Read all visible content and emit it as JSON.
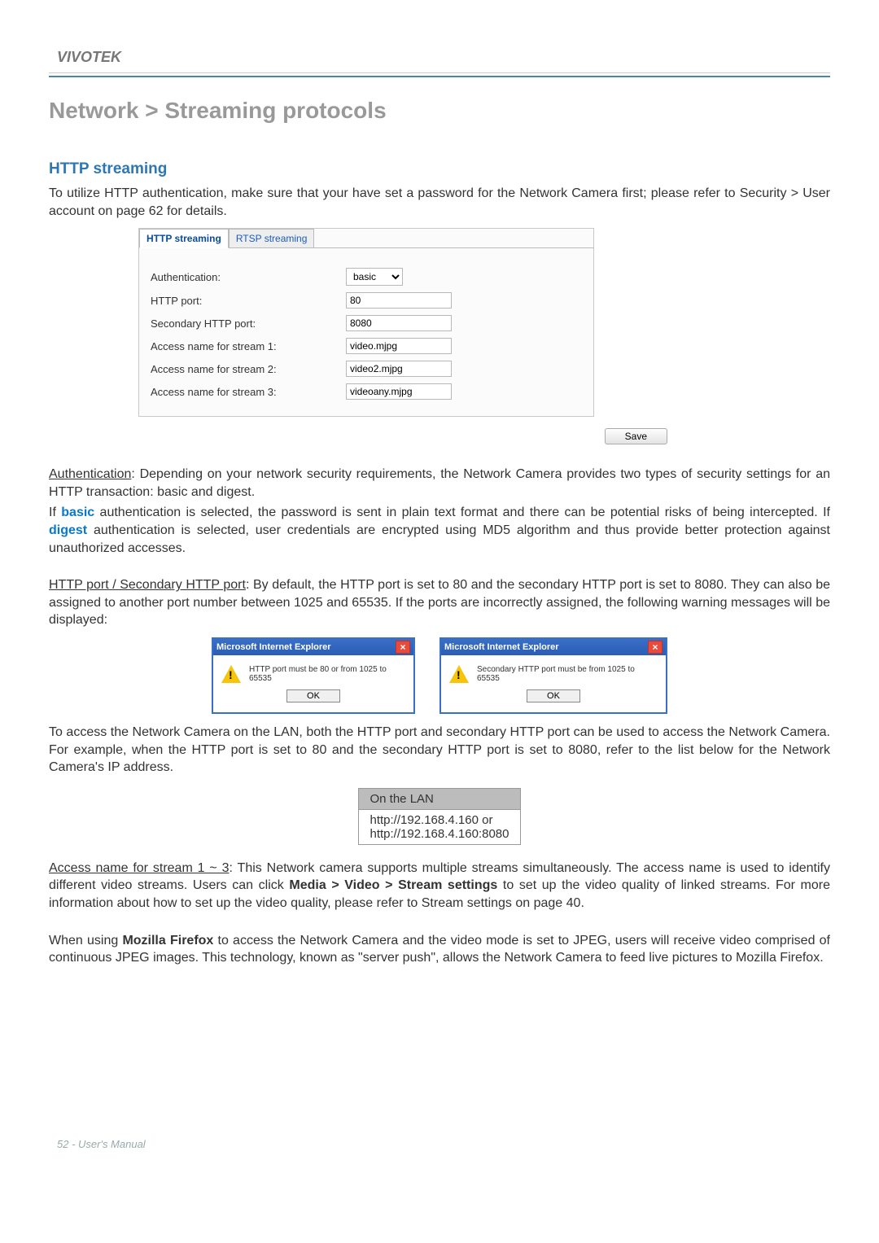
{
  "brand": "VIVOTEK",
  "title": "Network > Streaming protocols",
  "section": "HTTP streaming",
  "intro": "To utilize HTTP authentication, make sure that your have set a password for the Network Camera first; please refer to Security > User account on page 62 for details.",
  "tabs": {
    "http": "HTTP streaming",
    "rtsp": "RTSP streaming"
  },
  "form": {
    "auth_label": "Authentication:",
    "auth_value": "basic",
    "http_port_label": "HTTP port:",
    "http_port_value": "80",
    "sec_port_label": "Secondary HTTP port:",
    "sec_port_value": "8080",
    "s1_label": "Access name for stream 1:",
    "s1_value": "video.mjpg",
    "s2_label": "Access name for stream 2:",
    "s2_value": "video2.mjpg",
    "s3_label": "Access name for stream 3:",
    "s3_value": "videoany.mjpg",
    "save": "Save"
  },
  "para_auth_lead": "Authentication",
  "para_auth_rest": ": Depending on your network security requirements, the Network Camera provides two types of security settings for an HTTP transaction: basic and digest.",
  "para_basic_pre": "If ",
  "para_basic_kw": "basic",
  "para_basic_mid": " authentication is selected, the password is sent in plain text format and there can be potential risks of being intercepted. If ",
  "para_digest_kw": "digest",
  "para_basic_post": " authentication is selected, user credentials are encrypted using MD5 algorithm and thus provide better protection against unauthorized accesses.",
  "para_ports_lead": "HTTP port / Secondary HTTP port",
  "para_ports_rest": ": By default, the HTTP port is set to 80 and the secondary HTTP port is set to 8080. They can also be assigned to another port number between 1025 and 65535. If the ports are incorrectly assigned, the following warning messages will be displayed:",
  "dialog1": {
    "title": "Microsoft Internet Explorer",
    "msg": "HTTP port must be 80 or from 1025 to 65535",
    "ok": "OK"
  },
  "dialog2": {
    "title": "Microsoft Internet Explorer",
    "msg": "Secondary HTTP port must be from 1025 to 65535",
    "ok": "OK"
  },
  "para_lan": "To access the Network Camera on the LAN, both the HTTP port and secondary HTTP port can be used to access the Network Camera. For example, when the HTTP port is set to 80 and the secondary HTTP port is set to 8080, refer to the list below for the Network Camera's IP address.",
  "lan_table": {
    "header": "On the LAN",
    "row1": "http://192.168.4.160  or",
    "row2": "http://192.168.4.160:8080"
  },
  "para_access_lead": "Access name for stream 1 ~ 3",
  "para_access_mid1": ": This Network camera supports multiple streams simultaneously. The access name is used to identify different video streams. Users can click ",
  "para_access_bold": "Media > Video > Stream settings",
  "para_access_mid2": " to set up the video quality of linked streams. For more information about how to set up the video quality, please refer to Stream settings on page 40.",
  "para_firefox_pre": "When using ",
  "para_firefox_bold": "Mozilla Firefox",
  "para_firefox_post": " to access the Network Camera and the video mode is set to JPEG, users will receive video comprised of continuous JPEG images. This technology, known as \"server push\", allows the Network Camera to feed live pictures to Mozilla Firefox.",
  "footer": "52 - User's Manual"
}
